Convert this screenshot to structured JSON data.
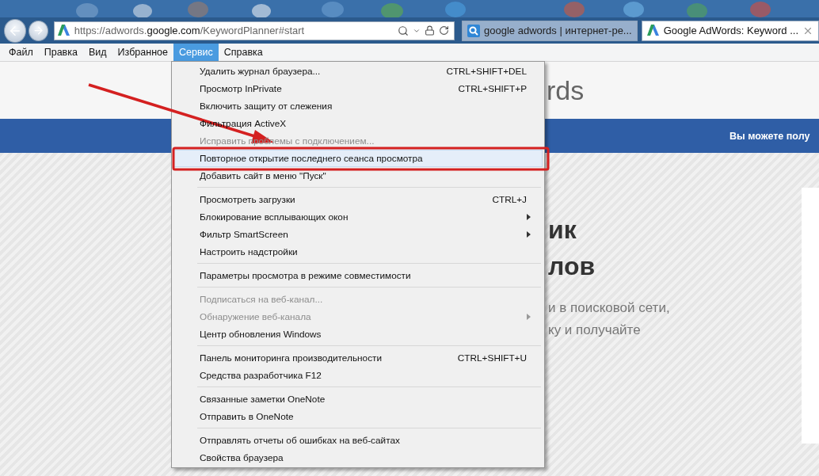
{
  "browser": {
    "address": "https://adwords.**google.com**/KeywordPlanner#start",
    "tabs": [
      {
        "label": "google adwords | интернет-ре...",
        "kind": "search",
        "selected": false
      },
      {
        "label": "Google AdWords: Keyword ...",
        "kind": "site",
        "selected": true
      }
    ]
  },
  "menu_bar": [
    {
      "label": "Файл",
      "selected": false
    },
    {
      "label": "Правка",
      "selected": false
    },
    {
      "label": "Вид",
      "selected": false
    },
    {
      "label": "Избранное",
      "selected": false
    },
    {
      "label": "Сервис",
      "selected": true
    },
    {
      "label": "Справка",
      "selected": false
    }
  ],
  "menu_groups": [
    [
      {
        "label": "Удалить журнал браузера...",
        "shortcut": "CTRL+SHIFT+DEL",
        "disabled": false,
        "submenu": false,
        "selected": false
      },
      {
        "label": "Просмотр InPrivate",
        "shortcut": "CTRL+SHIFT+P",
        "disabled": false,
        "submenu": false,
        "selected": false
      },
      {
        "label": "Включить защиту от слежения",
        "disabled": false,
        "submenu": false,
        "selected": false
      },
      {
        "label": "Фильтрация ActiveX",
        "disabled": false,
        "submenu": false,
        "selected": false
      },
      {
        "label": "Исправить проблемы с подключением...",
        "disabled": true,
        "submenu": false,
        "selected": false
      },
      {
        "label": "Повторное открытие последнего сеанса просмотра",
        "disabled": false,
        "submenu": false,
        "selected": true
      },
      {
        "label": "Добавить сайт в меню \"Пуск\"",
        "disabled": false,
        "submenu": false,
        "selected": false
      }
    ],
    [
      {
        "label": "Просмотреть загрузки",
        "shortcut": "CTRL+J",
        "disabled": false,
        "submenu": false,
        "selected": false
      },
      {
        "label": "Блокирование всплывающих окон",
        "disabled": false,
        "submenu": true,
        "selected": false
      },
      {
        "label": "Фильтр SmartScreen",
        "disabled": false,
        "submenu": true,
        "selected": false
      },
      {
        "label": "Настроить надстройки",
        "disabled": false,
        "submenu": false,
        "selected": false
      }
    ],
    [
      {
        "label": "Параметры просмотра в режиме совместимости",
        "disabled": false,
        "submenu": false,
        "selected": false
      }
    ],
    [
      {
        "label": "Подписаться на веб-канал...",
        "disabled": true,
        "submenu": false,
        "selected": false
      },
      {
        "label": "Обнаружение веб-канала",
        "disabled": true,
        "submenu": true,
        "selected": false
      },
      {
        "label": "Центр обновления Windows",
        "disabled": false,
        "submenu": false,
        "selected": false
      }
    ],
    [
      {
        "label": "Панель мониторинга производительности",
        "shortcut": "CTRL+SHIFT+U",
        "disabled": false,
        "submenu": false,
        "selected": false
      },
      {
        "label": "Средства разработчика F12",
        "disabled": false,
        "submenu": false,
        "selected": false
      }
    ],
    [
      {
        "label": "Связанные заметки OneNote",
        "disabled": false,
        "submenu": false,
        "selected": false
      },
      {
        "label": "Отправить в OneNote",
        "disabled": false,
        "submenu": false,
        "selected": false
      }
    ],
    [
      {
        "label": "Отправлять отчеты об ошибках на веб-сайтах",
        "disabled": false,
        "submenu": false,
        "selected": false
      },
      {
        "label": "Свойства браузера",
        "disabled": false,
        "submenu": false,
        "selected": false
      }
    ]
  ],
  "page": {
    "logo": "rds",
    "banner": "Вы можете полу",
    "heading_lines": [
      "ик",
      "лов"
    ],
    "text_lines": [
      "и в поисковой сети,",
      "ку и получайте"
    ]
  }
}
